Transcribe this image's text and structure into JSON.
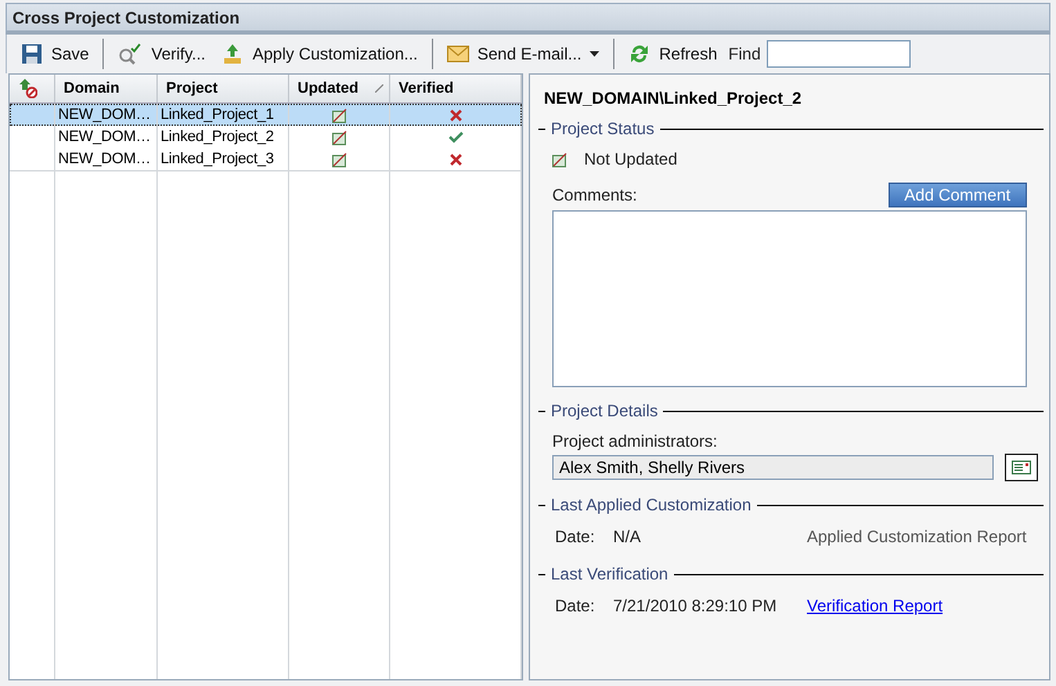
{
  "window": {
    "title": "Cross Project Customization"
  },
  "toolbar": {
    "items": [
      {
        "kind": "button",
        "label": "Save"
      },
      {
        "kind": "separator"
      },
      {
        "kind": "button",
        "label": "Verify..."
      },
      {
        "kind": "button",
        "label": "Apply Customization..."
      },
      {
        "kind": "separator"
      },
      {
        "kind": "dropdown",
        "label": "Send E-mail..."
      },
      {
        "kind": "separator"
      },
      {
        "kind": "button",
        "label": "Refresh"
      }
    ],
    "find": {
      "label": "Find"
    }
  },
  "table": {
    "columns": [
      "Domain",
      "Project",
      "Updated",
      "Verified"
    ],
    "rows": [
      {
        "domain": "NEW_DOM…",
        "project": "Linked_Project_1",
        "updated": false,
        "verified": false,
        "selected": true
      },
      {
        "domain": "NEW_DOM…",
        "project": "Linked_Project_2",
        "updated": false,
        "verified": true,
        "selected": false
      },
      {
        "domain": "NEW_DOM…",
        "project": "Linked_Project_3",
        "updated": false,
        "verified": false,
        "selected": false
      }
    ]
  },
  "details": {
    "heading": "NEW_DOMAIN\\Linked_Project_2",
    "status": {
      "title": "Project Status",
      "updated": false,
      "text": "Not Updated",
      "comments_label": "Comments:",
      "add_comment": "Add Comment"
    },
    "project_details": {
      "title": "Project Details",
      "admins_label": "Project administrators:",
      "admins": "Alex Smith, Shelly Rivers"
    },
    "last_applied": {
      "title": "Last Applied Customization",
      "date_label": "Date:",
      "date": "N/A",
      "report": "Applied Customization Report",
      "report_enabled": false
    },
    "last_verification": {
      "title": "Last Verification",
      "date_label": "Date:",
      "date": "7/21/2010 8:29:10 PM",
      "report": "Verification Report",
      "report_enabled": true
    }
  }
}
